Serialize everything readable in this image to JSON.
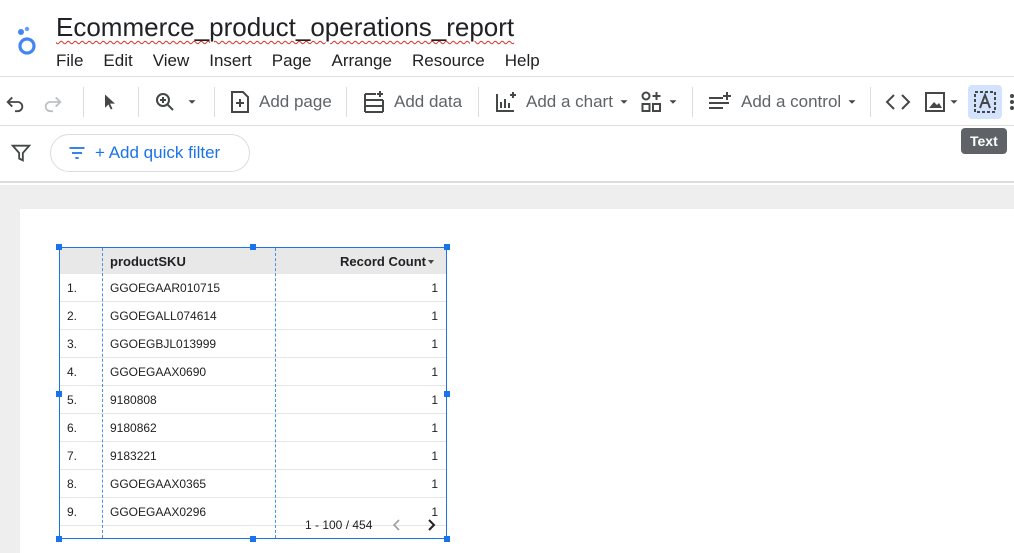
{
  "app": {
    "title": "Ecommerce_product_operations_report",
    "menu": [
      "File",
      "Edit",
      "View",
      "Insert",
      "Page",
      "Arrange",
      "Resource",
      "Help"
    ]
  },
  "toolbar": {
    "add_page": "Add page",
    "add_data": "Add data",
    "add_chart": "Add a chart",
    "add_control": "Add a control",
    "tooltip": "Text"
  },
  "filterbar": {
    "quick_filter": "+ Add quick filter"
  },
  "table": {
    "columns": [
      "productSKU",
      "Record Count"
    ],
    "rows": [
      {
        "num": "1.",
        "sku": "GGOEGAAR010715",
        "count": "1"
      },
      {
        "num": "2.",
        "sku": "GGOEGALL074614",
        "count": "1"
      },
      {
        "num": "3.",
        "sku": "GGOEGBJL013999",
        "count": "1"
      },
      {
        "num": "4.",
        "sku": "GGOEGAAX0690",
        "count": "1"
      },
      {
        "num": "5.",
        "sku": "9180808",
        "count": "1"
      },
      {
        "num": "6.",
        "sku": "9180862",
        "count": "1"
      },
      {
        "num": "7.",
        "sku": "9183221",
        "count": "1"
      },
      {
        "num": "8.",
        "sku": "GGOEGAAX0365",
        "count": "1"
      },
      {
        "num": "9.",
        "sku": "GGOEGAAX0296",
        "count": "1"
      }
    ],
    "pagination": "1 - 100 / 454"
  },
  "colors": {
    "accent": "#1a73e8",
    "selected_tool_bg": "#d3e3fd"
  }
}
